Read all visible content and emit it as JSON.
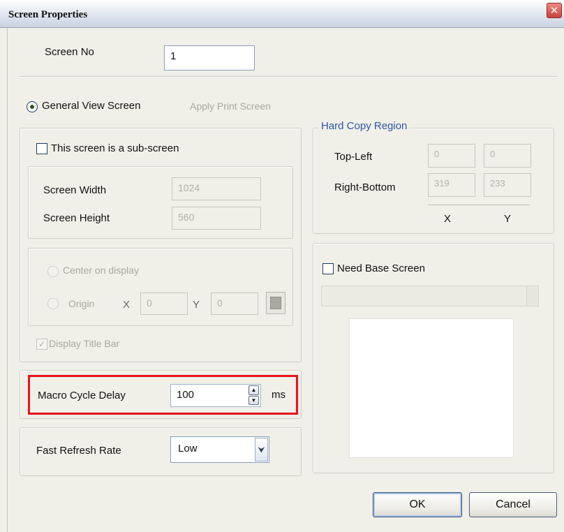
{
  "window": {
    "title": "Screen Properties",
    "close_glyph": "✕"
  },
  "screen_no": {
    "label": "Screen No",
    "value": "1"
  },
  "screen_type": {
    "general_view_label": "General View Screen",
    "apply_print_label": "Apply Print Screen"
  },
  "subscreen": {
    "checkbox_label": "This screen is a sub-screen",
    "width_label": "Screen Width",
    "width_value": "1024",
    "height_label": "Screen Height",
    "height_value": "560"
  },
  "position": {
    "center_label": "Center on display",
    "origin_label": "Origin",
    "x_label": "X",
    "x_value": "0",
    "y_label": "Y",
    "y_value": "0",
    "display_titlebar_label": "Display Title Bar"
  },
  "macro": {
    "label": "Macro Cycle Delay",
    "value": "100",
    "unit": "ms",
    "highlight_color": "#e8141b"
  },
  "refresh": {
    "label": "Fast Refresh Rate",
    "selected": "Low"
  },
  "hard_copy": {
    "title": "Hard Copy Region",
    "top_left_label": "Top-Left",
    "top_left_x": "0",
    "top_left_y": "0",
    "right_bottom_label": "Right-Bottom",
    "right_bottom_x": "319",
    "right_bottom_y": "233",
    "x_header": "X",
    "y_header": "Y"
  },
  "base_screen": {
    "checkbox_label": "Need Base Screen"
  },
  "buttons": {
    "ok": "OK",
    "cancel": "Cancel"
  },
  "icons": {
    "close": "close-icon",
    "spin_up": "spin-up-icon",
    "spin_down": "spin-down-icon",
    "dropdown": "chevron-down-icon",
    "checkmark": "checkmark-icon"
  }
}
